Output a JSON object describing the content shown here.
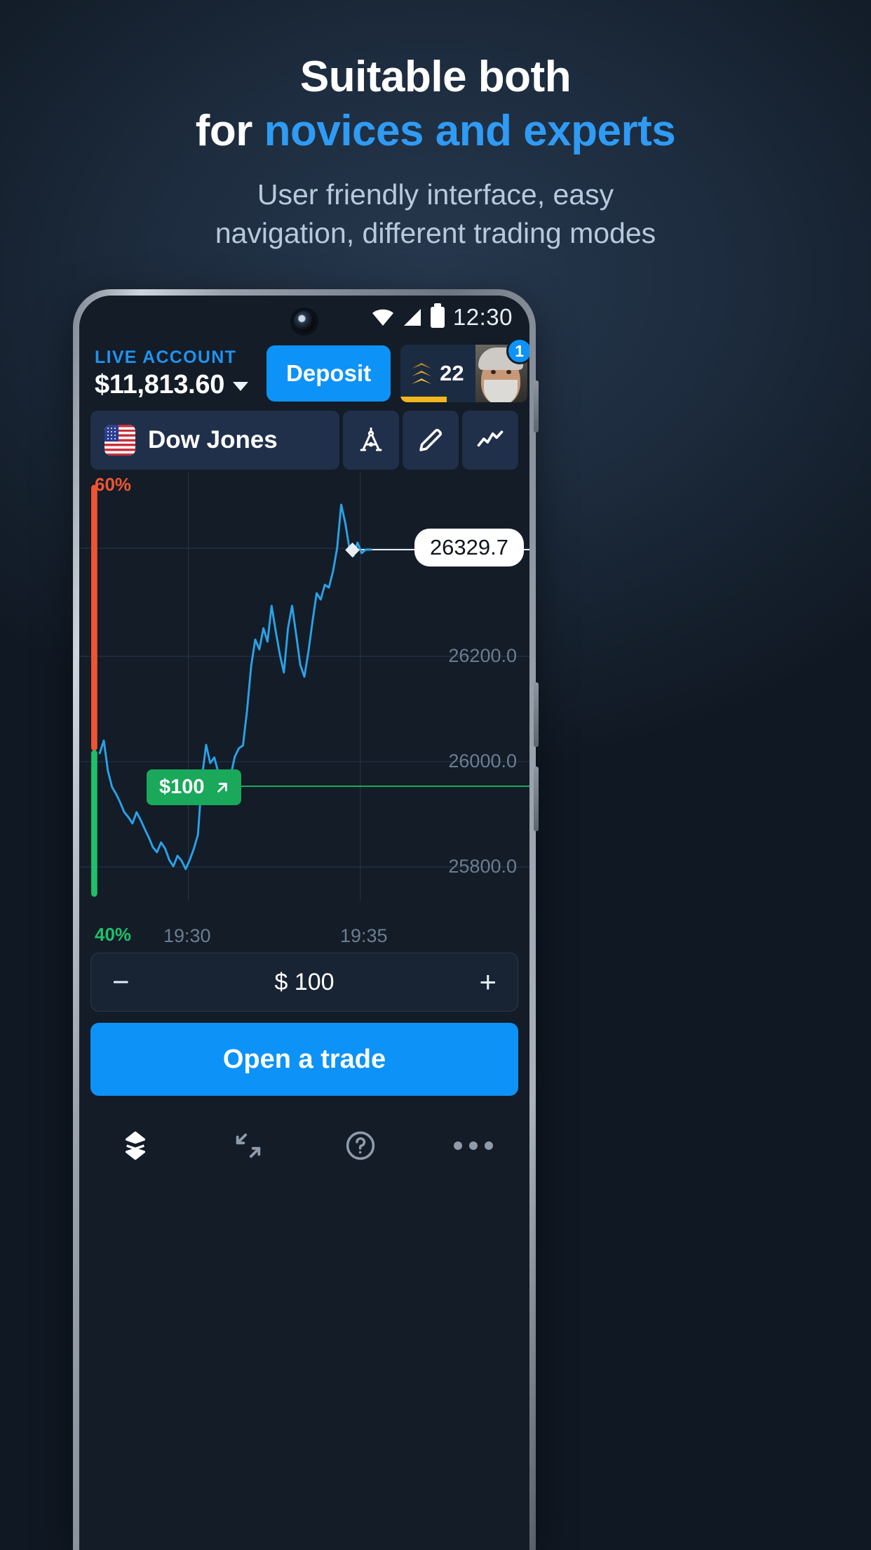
{
  "promo": {
    "headline_line1": "Suitable both",
    "headline_line2_prefix": "for ",
    "headline_line2_accent": "novices and experts",
    "subtitle_line1": "User friendly interface, easy",
    "subtitle_line2": "navigation, different trading modes",
    "accent_color": "#2f9bf4",
    "subtitle_color": "#b9c9dd"
  },
  "statusbar": {
    "time": "12:30",
    "icons": [
      "wifi-icon",
      "cellular-signal-icon",
      "battery-icon"
    ]
  },
  "account": {
    "label": "LIVE ACCOUNT",
    "balance": "$11,813.60",
    "chevron": "chevron-down-icon",
    "deposit_label": "Deposit",
    "rank_number": "22",
    "notification_count": "1"
  },
  "instrument": {
    "flag": "us-flag-icon",
    "name": "Dow Jones",
    "tools": [
      {
        "name": "compass-icon"
      },
      {
        "name": "pencil-icon"
      },
      {
        "name": "line-chart-icon"
      }
    ]
  },
  "chart_data": {
    "type": "line",
    "title": "Dow Jones",
    "xlabel": "",
    "ylabel": "",
    "x_ticks": [
      "19:30",
      "19:35"
    ],
    "y_ticks": [
      "26200.0",
      "26000.0",
      "25800.0"
    ],
    "ylim": [
      25700,
      26420
    ],
    "grid": true,
    "legend": "none",
    "line_color": "#2aa2e8",
    "current_price": "26329.7",
    "sentiment_up": "60%",
    "sentiment_down": "40%",
    "sentiment_up_color": "#ef5532",
    "sentiment_down_color": "#1fbf6a",
    "open_deal": {
      "label": "$100",
      "direction": "up",
      "price_level": 26000.0,
      "color": "#1aa85a"
    },
    "series": [
      {
        "name": "Dow Jones price",
        "values": [
          25990,
          26012,
          25965,
          25940,
          25930,
          25915,
          25900,
          25892,
          25880,
          25898,
          25885,
          25870,
          25855,
          25840,
          25832,
          25848,
          25838,
          25820,
          25810,
          25826,
          25818,
          25805,
          25820,
          25838,
          25860,
          25950,
          26005,
          25975,
          25985,
          25960,
          25948,
          25962,
          25955,
          25985,
          26000,
          26005,
          26060,
          26130,
          26175,
          26160,
          26195,
          26172,
          26230,
          26188,
          26150,
          26120,
          26195,
          26230,
          26185,
          26140,
          26120,
          26160,
          26210,
          26255,
          26245,
          26270,
          26265,
          26290,
          26330,
          26400,
          26370,
          26330,
          26318,
          26340,
          26322,
          26328,
          26330
        ]
      }
    ]
  },
  "trade": {
    "minus_label": "−",
    "plus_label": "+",
    "amount": "$ 100",
    "open_trade_label": "Open a trade"
  },
  "bottom_nav": {
    "items": [
      {
        "name": "trades-icon"
      },
      {
        "name": "fullscreen-icon"
      },
      {
        "name": "help-icon"
      },
      {
        "name": "more-icon"
      }
    ]
  }
}
